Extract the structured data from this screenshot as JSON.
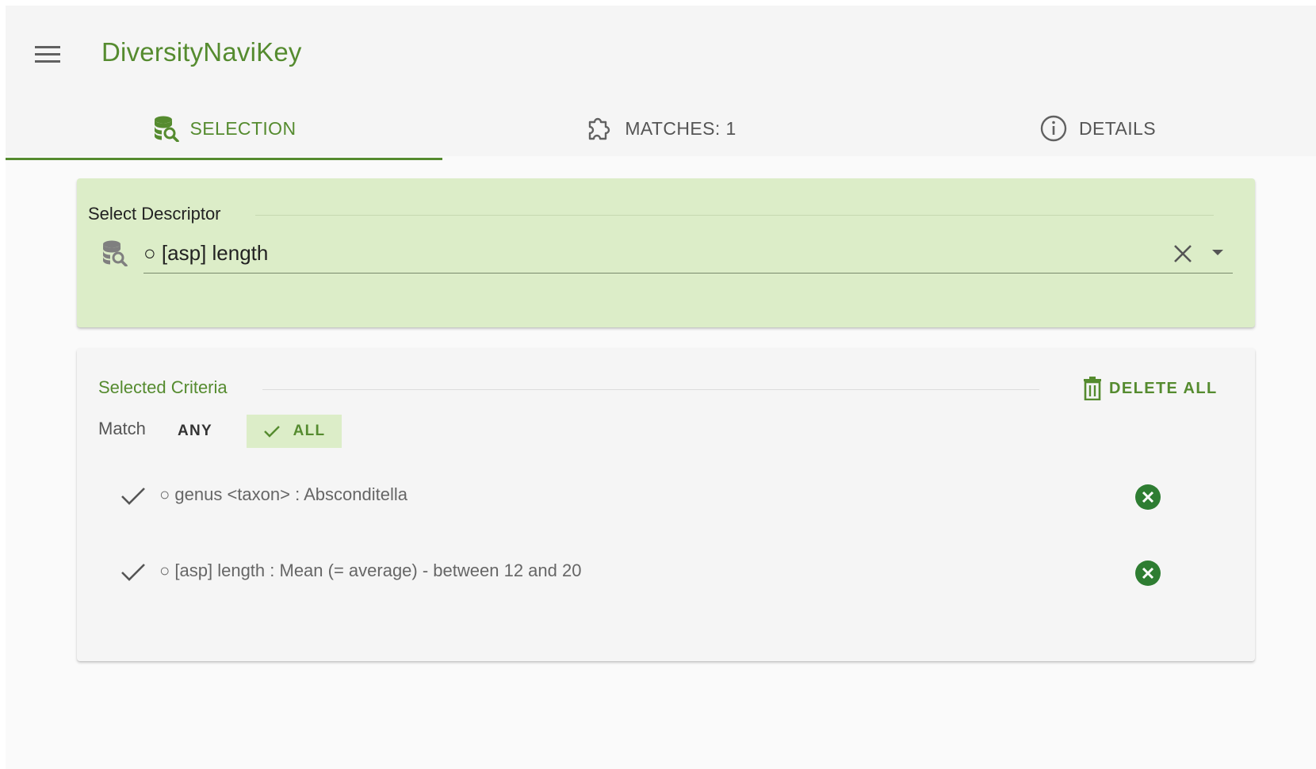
{
  "app": {
    "title": "DiversityNaviKey"
  },
  "tabs": [
    {
      "label": "SELECTION",
      "icon": "database-search-icon",
      "active": true
    },
    {
      "label": "MATCHES: 1",
      "icon": "puzzle-icon",
      "active": false
    },
    {
      "label": "DETAILS",
      "icon": "info-icon",
      "active": false
    }
  ],
  "descriptor": {
    "legend": "Select Descriptor",
    "value": "○ [asp] length"
  },
  "criteria": {
    "legend": "Selected Criteria",
    "delete_all_label": "DELETE ALL",
    "match_label": "Match",
    "match_any_label": "ANY",
    "match_all_label": "ALL",
    "match_mode": "ALL",
    "items": [
      {
        "text": "○ genus <taxon> : Absconditella"
      },
      {
        "text": "○ [asp] length : Mean (= average) - between 12 and 20"
      }
    ]
  },
  "colors": {
    "accent": "#558b2f",
    "descriptor_background": "#dcedc8",
    "remove_button": "#2e7d32"
  }
}
